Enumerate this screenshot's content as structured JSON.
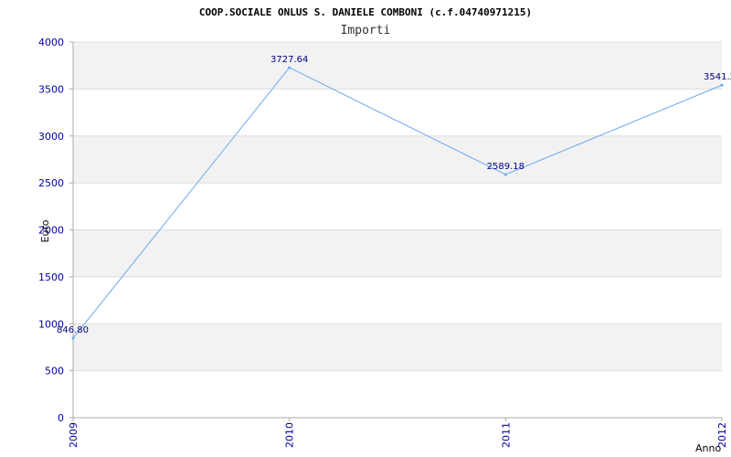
{
  "chart_data": {
    "type": "line",
    "title": "COOP.SOCIALE ONLUS S. DANIELE COMBONI (c.f.04740971215)",
    "subtitle": "Importi",
    "xlabel": "Anno",
    "ylabel": "Euro",
    "categories": [
      "2009",
      "2010",
      "2011",
      "2012"
    ],
    "series": [
      {
        "values": [
          846.8,
          3727.64,
          2589.18,
          3541.2
        ],
        "data_labels": [
          "846.80",
          "3727.64",
          "2589.18",
          "3541.2"
        ]
      }
    ],
    "ylim": [
      0,
      4000
    ],
    "yticks": [
      "0",
      "500",
      "1000",
      "1500",
      "2000",
      "2500",
      "3000",
      "3500",
      "4000"
    ],
    "grid": true,
    "legend": "none",
    "colors": {
      "line": "#6aa8ee",
      "band": "#f2f2f2",
      "gridline": "#dddddd",
      "tick_text": "#0000a0",
      "label_text": "#000080"
    }
  }
}
